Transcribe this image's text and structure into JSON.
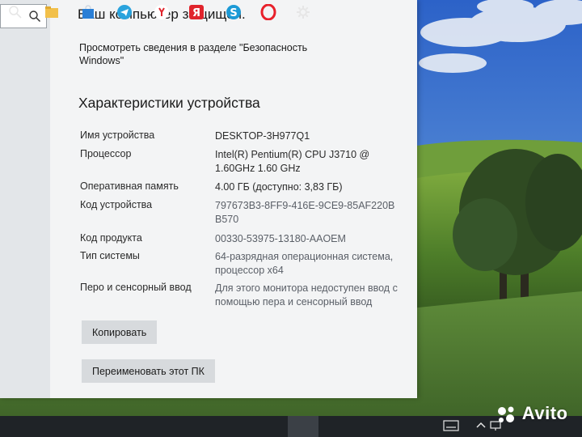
{
  "security": {
    "title": "Ваш компьютер защищен.",
    "link_text": "Просмотреть сведения в разделе \"Безопасность Windows\""
  },
  "specs": {
    "title": "Характеристики устройства",
    "rows": [
      {
        "label": "Имя устройства",
        "value": "DESKTOP-3H977Q1"
      },
      {
        "label": "Процессор",
        "value": "Intel(R) Pentium(R) CPU  J3710  @ 1.60GHz   1.60 GHz"
      },
      {
        "label": "Оперативная память",
        "value": "4.00 ГБ (доступно: 3,83 ГБ)"
      },
      {
        "label": "Код устройства",
        "value": "797673B3-8FF9-416E-9CE9-85AF220BB570"
      },
      {
        "label": "Код продукта",
        "value": "00330-53975-13180-AAOEM"
      },
      {
        "label": "Тип системы",
        "value": "64-разрядная операционная система, процессор x64"
      },
      {
        "label": "Перо и сенсорный ввод",
        "value": "Для этого монитора недоступен ввод с помощью пера и сенсорный ввод"
      }
    ]
  },
  "buttons": {
    "copy": "Копировать",
    "rename": "Переименовать этот ПК"
  },
  "taskbar": {
    "icons": [
      "search-icon",
      "file-explorer-icon",
      "store-icon",
      "telegram-icon",
      "yandex-browser-icon",
      "yandex-icon",
      "skype-icon",
      "opera-icon",
      "settings-icon"
    ],
    "tray": [
      "keyboard-icon",
      "chevron-up-icon",
      "network-icon"
    ]
  },
  "watermark": {
    "text": "Avito"
  },
  "colors": {
    "window_bg": "#f3f4f5",
    "button_bg": "#d7dadd",
    "taskbar_bg": "#1f2327"
  }
}
